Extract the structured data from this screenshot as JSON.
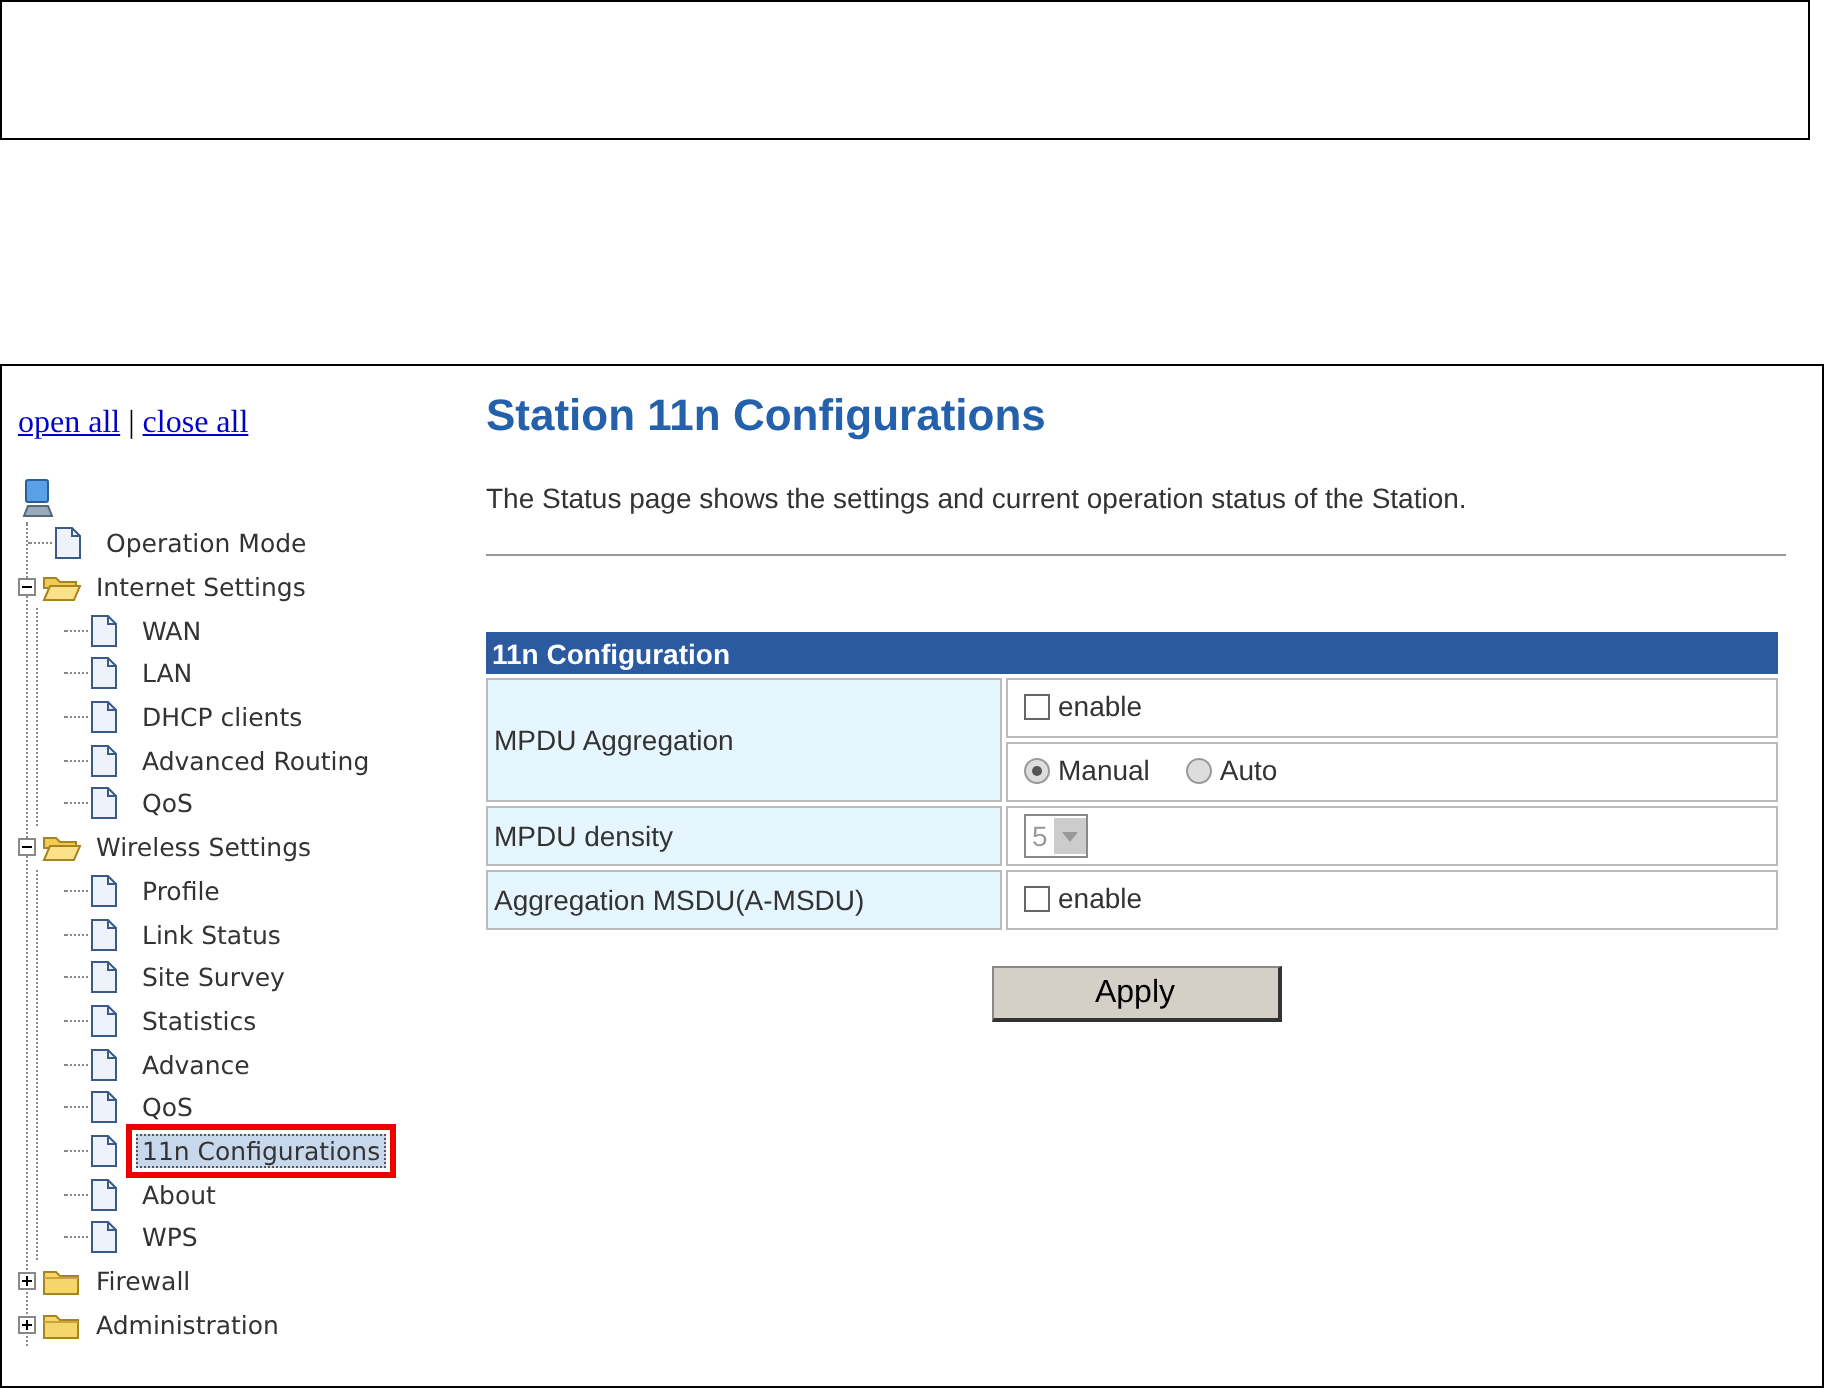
{
  "links": [
    {
      "label": "open all"
    },
    {
      "label": "close all"
    }
  ],
  "link_separator": "|",
  "tree": [
    {
      "kind": "page",
      "label": "Operation Mode",
      "selected": false
    },
    {
      "kind": "folder",
      "label": "Internet Settings",
      "expanded": true,
      "children": [
        {
          "kind": "page",
          "label": "WAN",
          "selected": false
        },
        {
          "kind": "page",
          "label": "LAN",
          "selected": false
        },
        {
          "kind": "page",
          "label": "DHCP clients",
          "selected": false
        },
        {
          "kind": "page",
          "label": "Advanced Routing",
          "selected": false
        },
        {
          "kind": "page",
          "label": "QoS",
          "selected": false
        }
      ]
    },
    {
      "kind": "folder",
      "label": "Wireless Settings",
      "expanded": true,
      "children": [
        {
          "kind": "page",
          "label": "Profile",
          "selected": false
        },
        {
          "kind": "page",
          "label": "Link Status",
          "selected": false
        },
        {
          "kind": "page",
          "label": "Site Survey",
          "selected": false
        },
        {
          "kind": "page",
          "label": "Statistics",
          "selected": false
        },
        {
          "kind": "page",
          "label": "Advance",
          "selected": false
        },
        {
          "kind": "page",
          "label": "QoS",
          "selected": false
        },
        {
          "kind": "page",
          "label": "11n Configurations",
          "selected": true
        },
        {
          "kind": "page",
          "label": "About",
          "selected": false
        },
        {
          "kind": "page",
          "label": "WPS",
          "selected": false
        }
      ]
    },
    {
      "kind": "folder",
      "label": "Firewall",
      "expanded": false
    },
    {
      "kind": "folder",
      "label": "Administration",
      "expanded": false
    }
  ],
  "page": {
    "title": "Station 11n Configurations",
    "description": "The Status page shows the settings and current operation status of the Station.",
    "table": {
      "header": "11n Configuration",
      "rows": [
        {
          "label": "MPDU Aggregation",
          "controls": [
            {
              "kind": "checkbox",
              "label": "enable",
              "checked": false
            },
            {
              "kind": "radios",
              "options": [
                {
                  "label": "Manual",
                  "selected": true
                },
                {
                  "label": "Auto",
                  "selected": false
                }
              ]
            }
          ]
        },
        {
          "label": "MPDU density",
          "controls": [
            {
              "kind": "select",
              "value": "5",
              "disabled": true
            }
          ]
        },
        {
          "label": "Aggregation MSDU(A-MSDU)",
          "controls": [
            {
              "kind": "checkbox",
              "label": "enable",
              "checked": false
            }
          ]
        }
      ]
    },
    "button": "Apply"
  }
}
